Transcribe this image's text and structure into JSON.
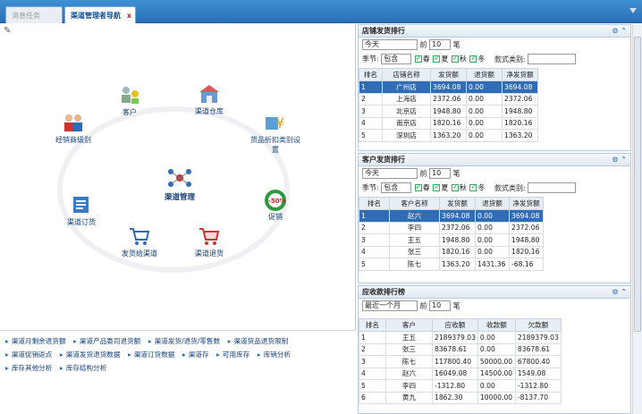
{
  "tabs": [
    {
      "label": "消息任务"
    },
    {
      "label": "渠道管理者导航"
    }
  ],
  "tab_close": "x",
  "center_label": "渠道管理",
  "nodes": [
    {
      "label": "客户"
    },
    {
      "label": "渠道仓库"
    },
    {
      "label": "经销商级别"
    },
    {
      "label": "货品折扣类别设置"
    },
    {
      "label": "渠道订货"
    },
    {
      "label": "促销"
    },
    {
      "label": "发货给渠道"
    },
    {
      "label": "渠道退货"
    }
  ],
  "links": [
    "渠道月剩余退货额",
    "渠道产品委司退货额",
    "渠道发货/退货/零售数",
    "渠道货品退货限制",
    "渠道促销返点",
    "渠道发货退货数据",
    "渠道订货数据",
    "渠道存",
    "可用库存",
    "库销分析",
    "库存其他分析",
    "库存结构分析"
  ],
  "promo_badge": "-50%",
  "store_panel": {
    "title": "店铺发货排行",
    "period": "今天",
    "front": "前",
    "topn": "10",
    "unit": "笔",
    "season_label": "季节:",
    "season_mode": "包含",
    "seasons": [
      "春",
      "夏",
      "秋",
      "冬"
    ],
    "style_label": "款式类别:",
    "columns": [
      "排名",
      "店铺名称",
      "发货额",
      "退货额",
      "净发货额"
    ],
    "rows": [
      [
        "1",
        "广州店",
        "3694.08",
        "0.00",
        "3694.08"
      ],
      [
        "2",
        "上海店",
        "2372.06",
        "0.00",
        "2372.06"
      ],
      [
        "3",
        "北京店",
        "1948.80",
        "0.00",
        "1948.80"
      ],
      [
        "4",
        "南京店",
        "1820.16",
        "0.00",
        "1820.16"
      ],
      [
        "5",
        "深圳店",
        "1363.20",
        "0.00",
        "1363.20"
      ]
    ]
  },
  "cust_panel": {
    "title": "客户发货排行",
    "period": "今天",
    "front": "前",
    "topn": "10",
    "unit": "笔",
    "season_label": "季节:",
    "season_mode": "包含",
    "seasons": [
      "春",
      "夏",
      "秋",
      "冬"
    ],
    "style_label": "款式类别:",
    "columns": [
      "排名",
      "客户名称",
      "发货额",
      "退货额",
      "净发货额"
    ],
    "rows": [
      [
        "1",
        "赵六",
        "3694.08",
        "0.00",
        "3694.08"
      ],
      [
        "2",
        "李四",
        "2372.06",
        "0.00",
        "2372.06"
      ],
      [
        "3",
        "王五",
        "1948.80",
        "0.00",
        "1948.80"
      ],
      [
        "4",
        "张三",
        "1820.16",
        "0.00",
        "1820.16"
      ],
      [
        "5",
        "陈七",
        "1363.20",
        "1431.36",
        "-68.16"
      ]
    ]
  },
  "recv_panel": {
    "title": "应收款排行榜",
    "period": "最近一个月",
    "front": "前",
    "topn": "10",
    "unit": "笔",
    "columns": [
      "排名",
      "客户",
      "应收额",
      "收款额",
      "欠款额"
    ],
    "rows": [
      [
        "1",
        "王五",
        "2189379.03",
        "0.00",
        "2189379.03"
      ],
      [
        "2",
        "张三",
        "83678.61",
        "0.00",
        "83678.61"
      ],
      [
        "3",
        "陈七",
        "117800.40",
        "50000.00",
        "67800.40"
      ],
      [
        "4",
        "赵六",
        "16049.08",
        "14500.00",
        "1549.08"
      ],
      [
        "5",
        "李四",
        "-1312.80",
        "0.00",
        "-1312.80"
      ],
      [
        "6",
        "黄九",
        "1862.30",
        "10000.00",
        "-8137.70"
      ]
    ]
  }
}
